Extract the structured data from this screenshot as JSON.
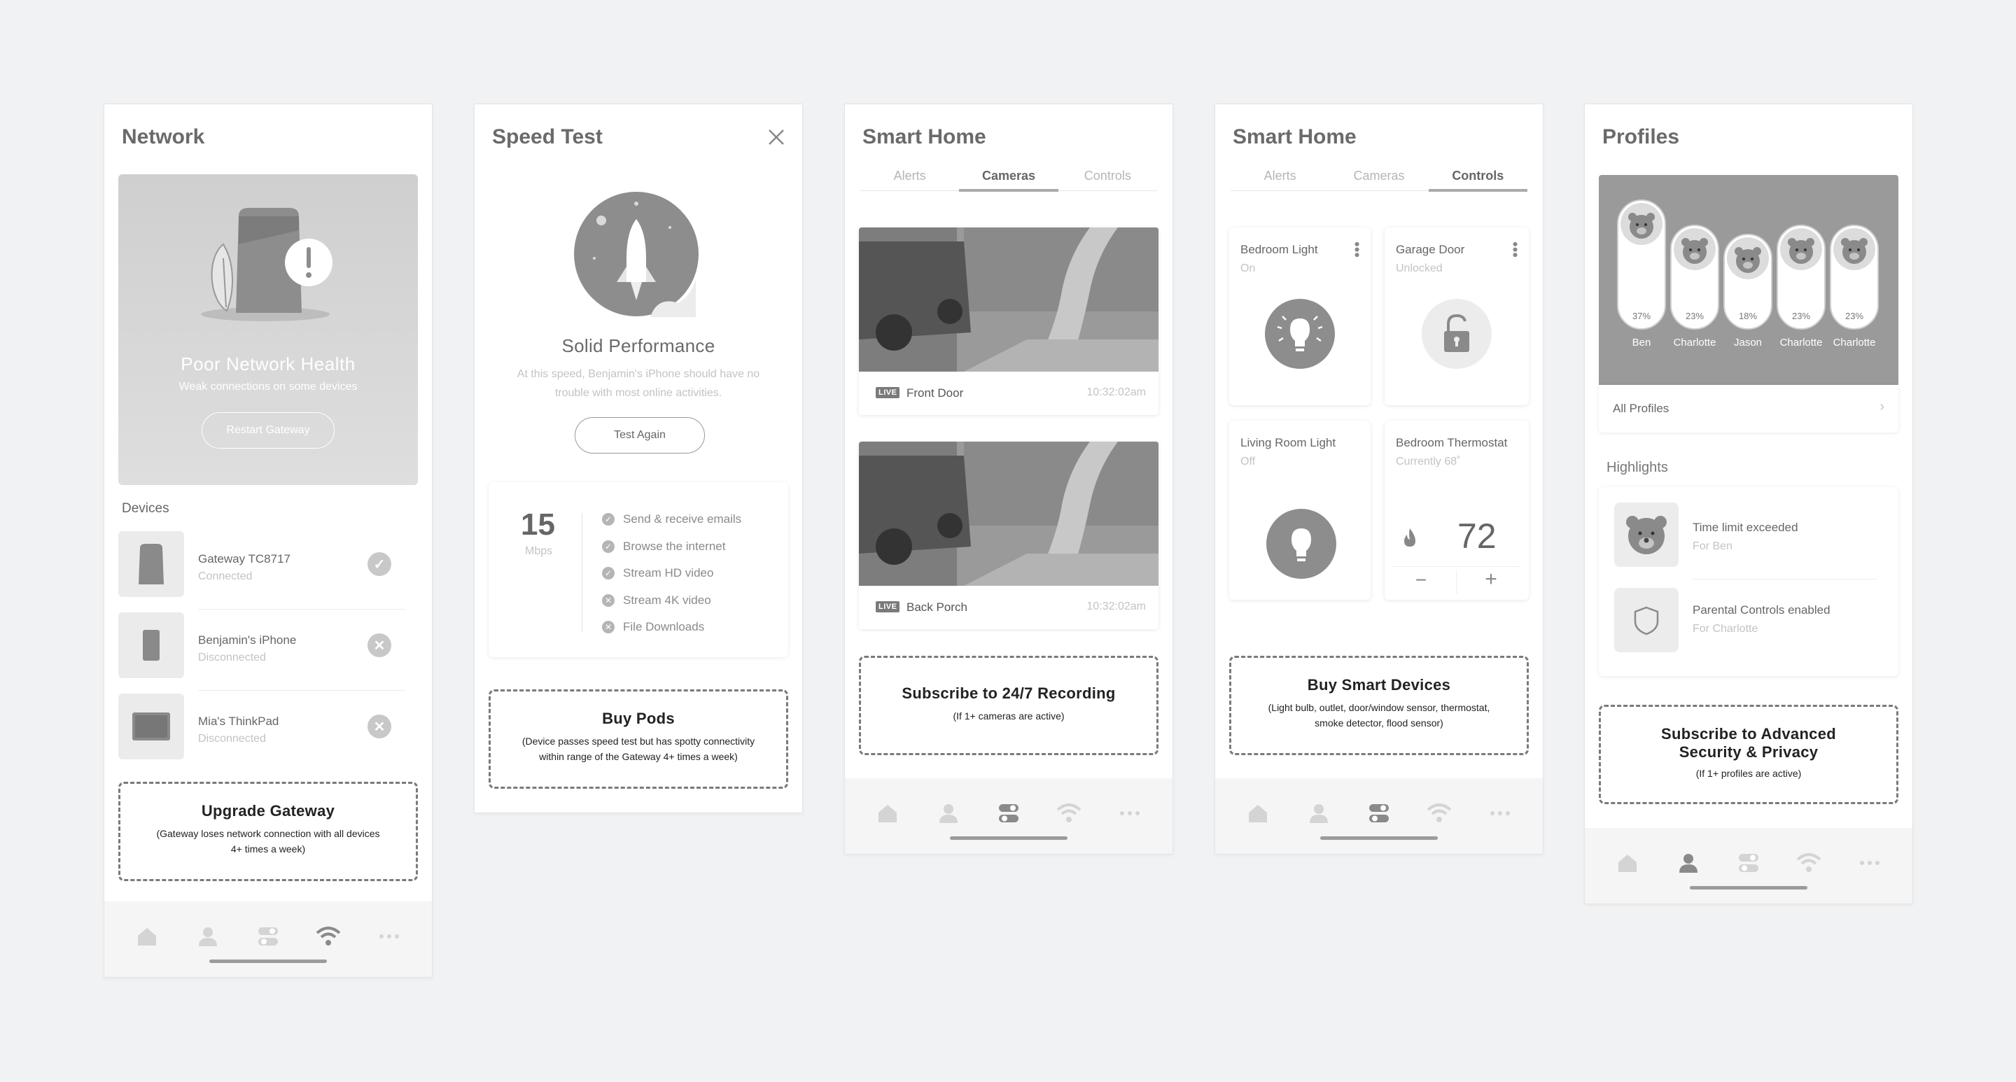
{
  "network": {
    "title": "Network",
    "health_title": "Poor Network Health",
    "health_sub": "Weak connections on some devices",
    "restart_label": "Restart Gateway",
    "devices_heading": "Devices",
    "devices": [
      {
        "name": "Gateway TC8717",
        "status": "Connected",
        "state": "ok"
      },
      {
        "name": "Benjamin's iPhone",
        "status": "Disconnected",
        "state": "error"
      },
      {
        "name": "Mia's ThinkPad",
        "status": "Disconnected",
        "state": "error"
      }
    ],
    "cta": {
      "title": "Upgrade Gateway",
      "sub1": "(Gateway loses network connection with all devices",
      "sub2": "4+ times a week)"
    }
  },
  "speed": {
    "title": "Speed Test",
    "result_title": "Solid Performance",
    "result_sub1": "At this speed, Benjamin's iPhone should have no",
    "result_sub2": "trouble with most online activities.",
    "test_again": "Test Again",
    "value": "15",
    "unit": "Mbps",
    "checks": [
      {
        "label": "Send & receive emails",
        "ok": true
      },
      {
        "label": "Browse the internet",
        "ok": true
      },
      {
        "label": "Stream HD video",
        "ok": true
      },
      {
        "label": "Stream 4K video",
        "ok": false
      },
      {
        "label": "File Downloads",
        "ok": false
      }
    ],
    "cta": {
      "title": "Buy Pods",
      "sub1": "(Device passes speed test but has spotty connectivity",
      "sub2": "within range of the Gateway 4+ times a week)"
    }
  },
  "cameras": {
    "title": "Smart Home",
    "tabs": [
      "Alerts",
      "Cameras",
      "Controls"
    ],
    "active_tab": "Cameras",
    "live_label": "LIVE",
    "items": [
      {
        "name": "Front Door",
        "time": "10:32:02am"
      },
      {
        "name": "Back Porch",
        "time": "10:32:02am"
      }
    ],
    "cta": {
      "title": "Subscribe to 24/7 Recording",
      "sub1": "(If 1+ cameras are active)"
    }
  },
  "controls": {
    "title": "Smart Home",
    "tabs": [
      "Alerts",
      "Cameras",
      "Controls"
    ],
    "active_tab": "Controls",
    "items": [
      {
        "name": "Bedroom Light",
        "status": "On"
      },
      {
        "name": "Garage Door",
        "status": "Unlocked"
      },
      {
        "name": "Living Room Light",
        "status": "Off"
      },
      {
        "name": "Bedroom Thermostat",
        "status": "Currently 68˚"
      }
    ],
    "thermostat_value": "72",
    "minus": "−",
    "plus": "+",
    "cta": {
      "title": "Buy Smart Devices",
      "sub1": "(Light bulb, outlet, door/window sensor, thermostat,",
      "sub2": "smoke detector, flood sensor)"
    }
  },
  "profiles": {
    "title": "Profiles",
    "people": [
      {
        "name": "Ben",
        "pct": "37%",
        "pct_value": 0.37
      },
      {
        "name": "Charlotte",
        "pct": "23%",
        "pct_value": 0.23
      },
      {
        "name": "Jason",
        "pct": "18%",
        "pct_value": 0.18
      },
      {
        "name": "Charlotte",
        "pct": "23%",
        "pct_value": 0.23
      },
      {
        "name": "Charlotte",
        "pct": "23%",
        "pct_value": 0.23
      }
    ],
    "all_profiles": "All Profiles",
    "highlights_heading": "Highlights",
    "highlights": [
      {
        "title": "Time limit exceeded",
        "sub": "For Ben"
      },
      {
        "title": "Parental Controls enabled",
        "sub": "For Charlotte"
      }
    ],
    "cta": {
      "title1": "Subscribe to Advanced",
      "title2": "Security & Privacy",
      "sub1": "(If 1+ profiles are active)"
    }
  },
  "nav": {
    "icons": [
      "home-icon",
      "person-icon",
      "toggles-icon",
      "wifi-icon",
      "more-icon"
    ]
  }
}
